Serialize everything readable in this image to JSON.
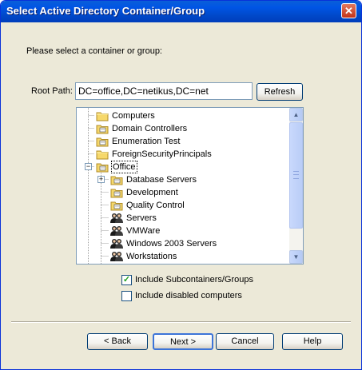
{
  "window": {
    "title": "Select Active Directory Container/Group",
    "close_glyph": "✕"
  },
  "prompt": "Please select a container or group:",
  "root_path": {
    "label": "Root Path:",
    "value": "DC=office,DC=netikus,DC=net"
  },
  "refresh_label": "Refresh",
  "tree": {
    "nodes": [
      {
        "label": "Computers",
        "icon": "folder-icon",
        "selected": false
      },
      {
        "label": "Domain Controllers",
        "icon": "ou-folder-icon",
        "selected": false
      },
      {
        "label": "Enumeration Test",
        "icon": "ou-folder-icon",
        "selected": false
      },
      {
        "label": "ForeignSecurityPrincipals",
        "icon": "folder-icon",
        "selected": false
      },
      {
        "label": "Office",
        "icon": "ou-folder-icon",
        "selected": true,
        "expanded": true
      },
      {
        "label": "Database Servers",
        "icon": "ou-folder-icon",
        "selected": false,
        "collapsed": true
      },
      {
        "label": "Development",
        "icon": "ou-folder-icon",
        "selected": false
      },
      {
        "label": "Quality Control",
        "icon": "ou-folder-icon",
        "selected": false
      },
      {
        "label": "Servers",
        "icon": "group-icon",
        "selected": false
      },
      {
        "label": "VMWare",
        "icon": "group-icon",
        "selected": false
      },
      {
        "label": "Windows 2003 Servers",
        "icon": "group-icon",
        "selected": false
      },
      {
        "label": "Workstations",
        "icon": "group-icon",
        "selected": false
      }
    ]
  },
  "options": {
    "include_subcontainers": {
      "label": "Include Subcontainers/Groups",
      "checked": true
    },
    "include_disabled": {
      "label": "Include disabled computers",
      "checked": false
    }
  },
  "buttons": {
    "back": "< Back",
    "next": "Next >",
    "cancel": "Cancel",
    "help": "Help"
  }
}
